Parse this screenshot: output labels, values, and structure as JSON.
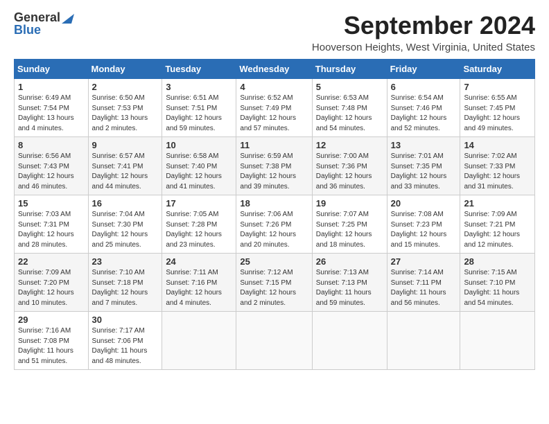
{
  "header": {
    "logo_general": "General",
    "logo_blue": "Blue",
    "title": "September 2024",
    "location": "Hooverson Heights, West Virginia, United States"
  },
  "calendar": {
    "columns": [
      "Sunday",
      "Monday",
      "Tuesday",
      "Wednesday",
      "Thursday",
      "Friday",
      "Saturday"
    ],
    "weeks": [
      [
        {
          "day": "1",
          "sunrise": "6:49 AM",
          "sunset": "7:54 PM",
          "daylight": "13 hours and 4 minutes"
        },
        {
          "day": "2",
          "sunrise": "6:50 AM",
          "sunset": "7:53 PM",
          "daylight": "13 hours and 2 minutes"
        },
        {
          "day": "3",
          "sunrise": "6:51 AM",
          "sunset": "7:51 PM",
          "daylight": "12 hours and 59 minutes"
        },
        {
          "day": "4",
          "sunrise": "6:52 AM",
          "sunset": "7:49 PM",
          "daylight": "12 hours and 57 minutes"
        },
        {
          "day": "5",
          "sunrise": "6:53 AM",
          "sunset": "7:48 PM",
          "daylight": "12 hours and 54 minutes"
        },
        {
          "day": "6",
          "sunrise": "6:54 AM",
          "sunset": "7:46 PM",
          "daylight": "12 hours and 52 minutes"
        },
        {
          "day": "7",
          "sunrise": "6:55 AM",
          "sunset": "7:45 PM",
          "daylight": "12 hours and 49 minutes"
        }
      ],
      [
        {
          "day": "8",
          "sunrise": "6:56 AM",
          "sunset": "7:43 PM",
          "daylight": "12 hours and 46 minutes"
        },
        {
          "day": "9",
          "sunrise": "6:57 AM",
          "sunset": "7:41 PM",
          "daylight": "12 hours and 44 minutes"
        },
        {
          "day": "10",
          "sunrise": "6:58 AM",
          "sunset": "7:40 PM",
          "daylight": "12 hours and 41 minutes"
        },
        {
          "day": "11",
          "sunrise": "6:59 AM",
          "sunset": "7:38 PM",
          "daylight": "12 hours and 39 minutes"
        },
        {
          "day": "12",
          "sunrise": "7:00 AM",
          "sunset": "7:36 PM",
          "daylight": "12 hours and 36 minutes"
        },
        {
          "day": "13",
          "sunrise": "7:01 AM",
          "sunset": "7:35 PM",
          "daylight": "12 hours and 33 minutes"
        },
        {
          "day": "14",
          "sunrise": "7:02 AM",
          "sunset": "7:33 PM",
          "daylight": "12 hours and 31 minutes"
        }
      ],
      [
        {
          "day": "15",
          "sunrise": "7:03 AM",
          "sunset": "7:31 PM",
          "daylight": "12 hours and 28 minutes"
        },
        {
          "day": "16",
          "sunrise": "7:04 AM",
          "sunset": "7:30 PM",
          "daylight": "12 hours and 25 minutes"
        },
        {
          "day": "17",
          "sunrise": "7:05 AM",
          "sunset": "7:28 PM",
          "daylight": "12 hours and 23 minutes"
        },
        {
          "day": "18",
          "sunrise": "7:06 AM",
          "sunset": "7:26 PM",
          "daylight": "12 hours and 20 minutes"
        },
        {
          "day": "19",
          "sunrise": "7:07 AM",
          "sunset": "7:25 PM",
          "daylight": "12 hours and 18 minutes"
        },
        {
          "day": "20",
          "sunrise": "7:08 AM",
          "sunset": "7:23 PM",
          "daylight": "12 hours and 15 minutes"
        },
        {
          "day": "21",
          "sunrise": "7:09 AM",
          "sunset": "7:21 PM",
          "daylight": "12 hours and 12 minutes"
        }
      ],
      [
        {
          "day": "22",
          "sunrise": "7:09 AM",
          "sunset": "7:20 PM",
          "daylight": "12 hours and 10 minutes"
        },
        {
          "day": "23",
          "sunrise": "7:10 AM",
          "sunset": "7:18 PM",
          "daylight": "12 hours and 7 minutes"
        },
        {
          "day": "24",
          "sunrise": "7:11 AM",
          "sunset": "7:16 PM",
          "daylight": "12 hours and 4 minutes"
        },
        {
          "day": "25",
          "sunrise": "7:12 AM",
          "sunset": "7:15 PM",
          "daylight": "12 hours and 2 minutes"
        },
        {
          "day": "26",
          "sunrise": "7:13 AM",
          "sunset": "7:13 PM",
          "daylight": "11 hours and 59 minutes"
        },
        {
          "day": "27",
          "sunrise": "7:14 AM",
          "sunset": "7:11 PM",
          "daylight": "11 hours and 56 minutes"
        },
        {
          "day": "28",
          "sunrise": "7:15 AM",
          "sunset": "7:10 PM",
          "daylight": "11 hours and 54 minutes"
        }
      ],
      [
        {
          "day": "29",
          "sunrise": "7:16 AM",
          "sunset": "7:08 PM",
          "daylight": "11 hours and 51 minutes"
        },
        {
          "day": "30",
          "sunrise": "7:17 AM",
          "sunset": "7:06 PM",
          "daylight": "11 hours and 48 minutes"
        },
        null,
        null,
        null,
        null,
        null
      ]
    ]
  }
}
